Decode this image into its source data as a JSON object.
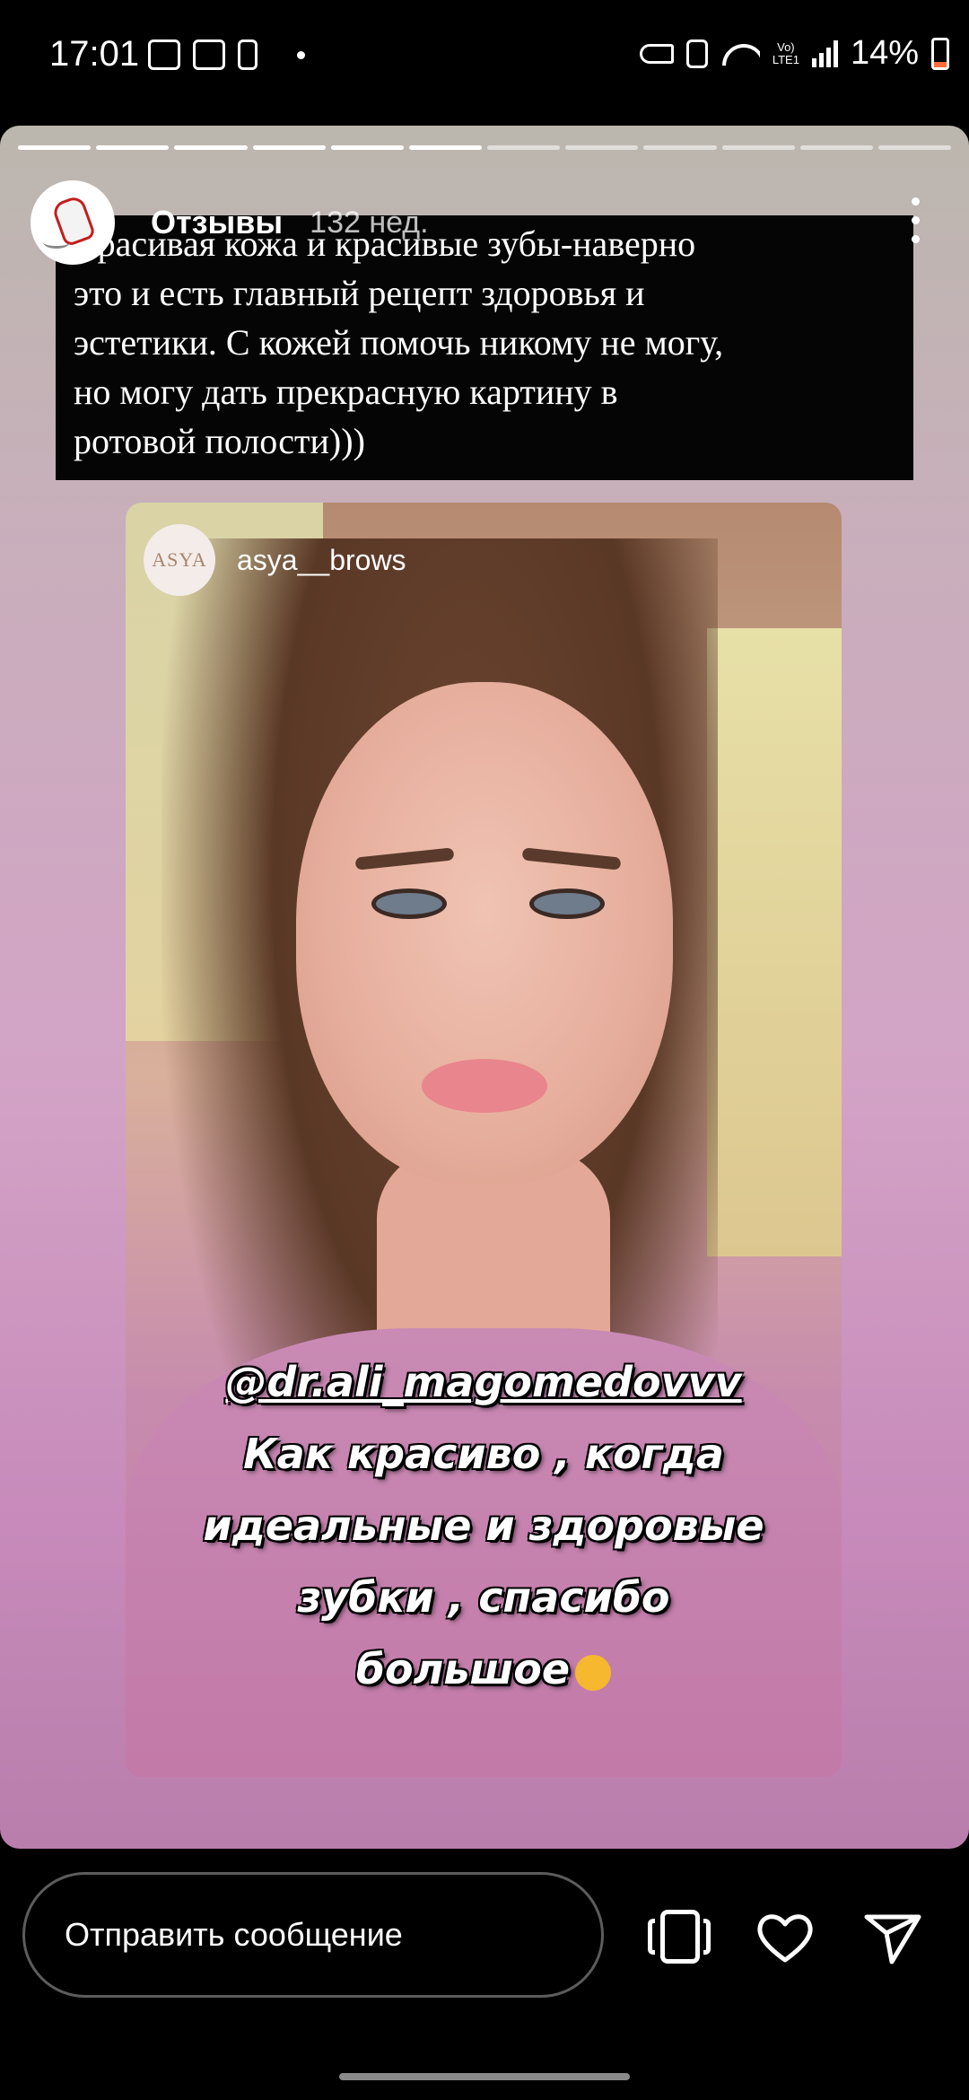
{
  "status_bar": {
    "time": "17:01",
    "lte_label": "Vo)\nLTE1",
    "battery": "14%",
    "icons": [
      "gallery-icon",
      "analytics-icon",
      "alert-icon",
      "dot-icon",
      "key-icon",
      "recycle-icon",
      "wifi-icon",
      "signal-icon",
      "battery-icon"
    ]
  },
  "story": {
    "progress_total": 12,
    "progress_done": 6,
    "user": "Отзывы",
    "age": "132 нед.",
    "caption": "Красивая кожа и красивые зубы-наверно\nэто и есть главный рецепт здоровья и\nэстетики. С кожей помочь никому не могу,\nно могу дать прекрасную картину в\nротовой полости)))",
    "embedded": {
      "username": "asya__brows",
      "avatar_text": "ASYA",
      "mention": "@dr.ali_magomedovvv",
      "line1": "Как красиво , когда",
      "line2": "идеальные и здоровые",
      "line3": "зубки , спасибо",
      "line4": "большое"
    }
  },
  "reply_bar": {
    "placeholder": "Отправить сообщение"
  }
}
